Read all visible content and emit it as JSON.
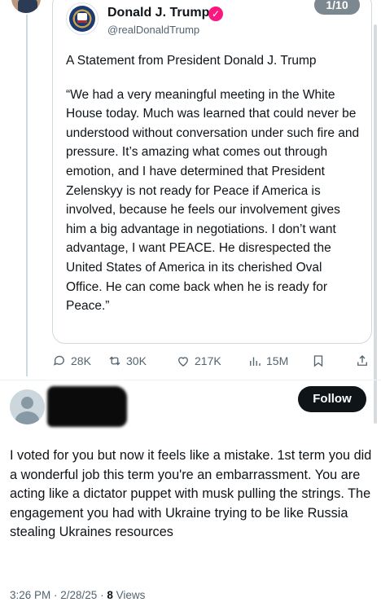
{
  "thread": {
    "counter": "1/10"
  },
  "quoted_post": {
    "author_name": "Donald J. Trump",
    "author_handle": "@realDonaldTrump",
    "heading": "A Statement from President Donald J. Trump",
    "body": "“We had a very meaningful meeting in the White House today. Much was learned that could never be understood without conversation under such fire and pressure. It’s amazing what comes out through emotion, and I have determined that President Zelenskyy is not ready for Peace if America is involved, because he feels our involvement gives him a big advantage in negotiations. I don’t want advantage, I want PEACE. He disrespected the United States of America in its cherished Oval Office. He can come back when he is ready for Peace.”"
  },
  "actions": {
    "replies": "28K",
    "reposts": "30K",
    "likes": "217K",
    "views": "15M"
  },
  "reply": {
    "follow_label": "Follow",
    "text": "I voted for you but now it feels like a mistake. 1st term you did a wonderful job this term you're an embarrassment. You are acting like a dictator puppet with musk pulling the strings. The engagement you had with Ukraine trying to be like Russia stealing Ukraines resources",
    "timestamp": "3:26 PM · 2/28/25 · ",
    "views_count": "8",
    "views_label": " Views"
  },
  "colors": {
    "text_primary": "#0f1419",
    "text_secondary": "#536471",
    "border": "#cfd9de",
    "verified_badge": "#f91880",
    "follow_button": "#0f1419"
  },
  "icons": [
    "reply-icon",
    "repost-icon",
    "like-icon",
    "views-icon",
    "bookmark-icon",
    "share-icon",
    "verified-badge-icon"
  ]
}
